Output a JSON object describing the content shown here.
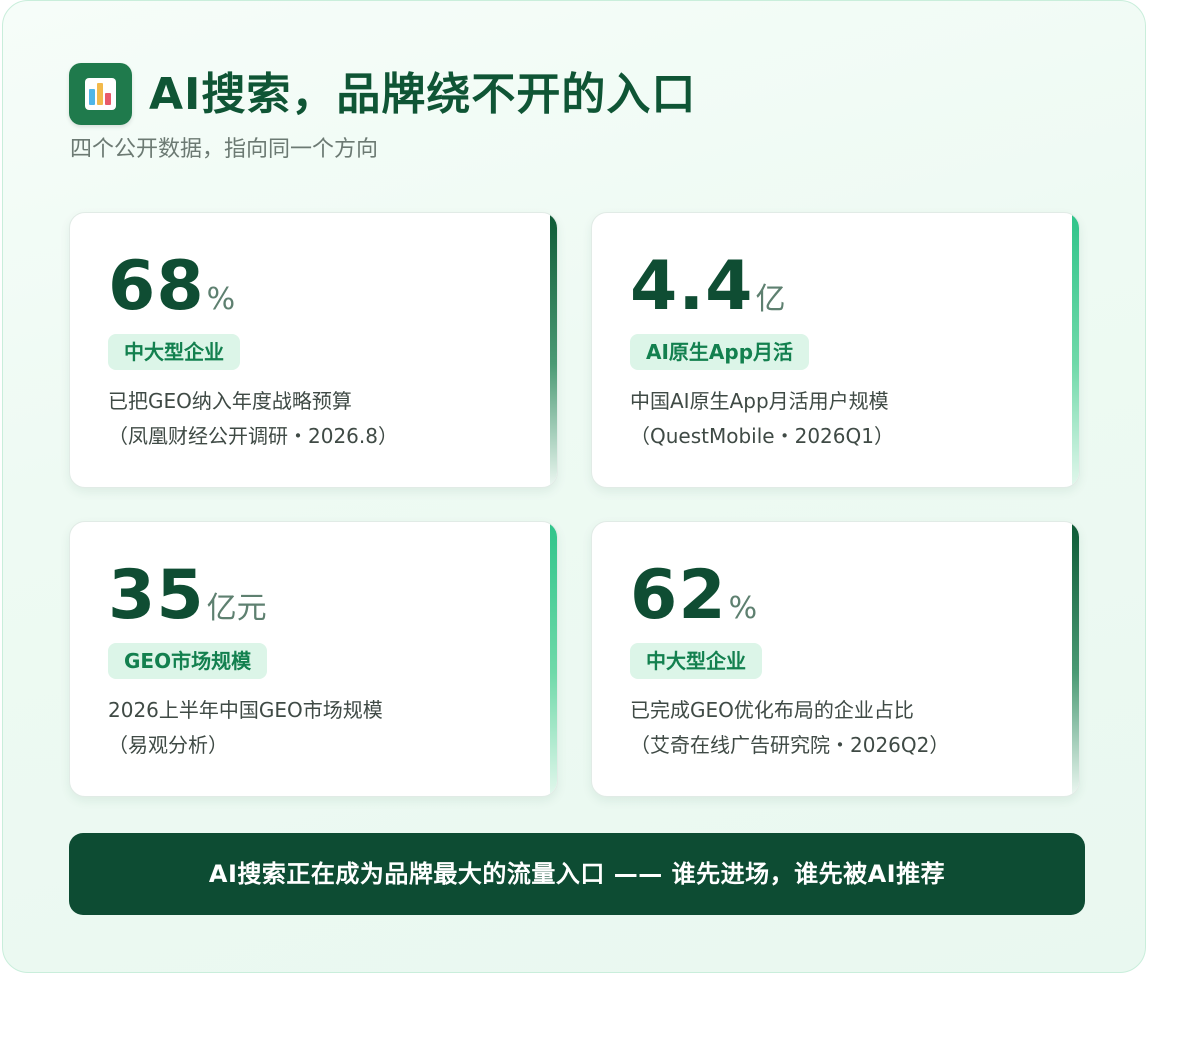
{
  "header": {
    "title": "AI搜索，品牌绕不开的入口",
    "subtitle": "四个公开数据，指向同一个方向",
    "icon": "bar-chart-icon"
  },
  "cards": [
    {
      "value": "68",
      "unit": "%",
      "tag": "中大型企业",
      "description": "已把GEO纳入年度战略预算",
      "source": "（凤凰财经公开调研・2026.8）"
    },
    {
      "value": "4.4",
      "unit": "亿",
      "tag": "AI原生App月活",
      "description": "中国AI原生App月活用户规模",
      "source": "（QuestMobile・2026Q1）"
    },
    {
      "value": "35",
      "unit": "亿元",
      "tag": "GEO市场规模",
      "description": "2026上半年中国GEO市场规模",
      "source": "（易观分析）"
    },
    {
      "value": "62",
      "unit": "%",
      "tag": "中大型企业",
      "description": "已完成GEO优化布局的企业占比",
      "source": "（艾奇在线广告研究院・2026Q2）"
    }
  ],
  "banner": {
    "text": "AI搜索正在成为品牌最大的流量入口 —— 谁先进场，谁先被AI推荐"
  },
  "colors": {
    "primary_dark": "#0d4c33",
    "accent_green": "#2fc48a",
    "tag_background": "#dcf5e8",
    "tag_text": "#13804f"
  }
}
